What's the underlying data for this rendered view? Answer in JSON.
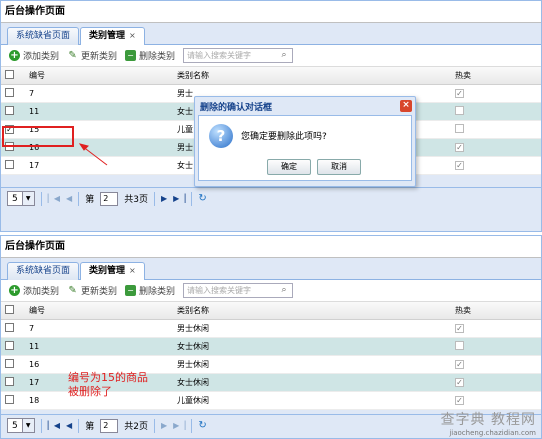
{
  "panel_title": "后台操作页面",
  "tabs": [
    {
      "label": "系统缺省页面",
      "closable": false
    },
    {
      "label": "类别管理",
      "closable": true,
      "close_glyph": "×"
    }
  ],
  "toolbar": {
    "add_label": "添加类别",
    "update_label": "更新类别",
    "delete_label": "删除类别",
    "search_placeholder": "请输入搜索关键字"
  },
  "grid_columns": {
    "num": "编号",
    "name": "类别名称",
    "hot": "热卖"
  },
  "grid_before": {
    "rows": [
      {
        "num": "7",
        "name": "男士",
        "hot_checked": true
      },
      {
        "num": "11",
        "name": "女士",
        "hot_checked": false
      },
      {
        "num": "15",
        "name": "儿童",
        "hot_checked": false,
        "selected": true
      },
      {
        "num": "16",
        "name": "男士",
        "hot_checked": true
      },
      {
        "num": "17",
        "name": "女士",
        "hot_checked": true
      }
    ]
  },
  "pager_before": {
    "page_size": "5",
    "page_prefix": "第",
    "page_value": "2",
    "page_total": "共3页"
  },
  "dialog": {
    "title": "删除的确认对话框",
    "message": "您确定要删除此项吗?",
    "ok_label": "确定",
    "cancel_label": "取消"
  },
  "grid_after": {
    "rows": [
      {
        "num": "7",
        "name": "男士休闲",
        "hot_checked": true
      },
      {
        "num": "11",
        "name": "女士休闲",
        "hot_checked": false
      },
      {
        "num": "16",
        "name": "男士休闲",
        "hot_checked": true
      },
      {
        "num": "17",
        "name": "女士休闲",
        "hot_checked": true
      },
      {
        "num": "18",
        "name": "儿童休闲",
        "hot_checked": true
      }
    ]
  },
  "pager_after": {
    "page_size": "5",
    "page_prefix": "第",
    "page_value": "2",
    "page_total": "共2页"
  },
  "annotation": {
    "line1": "编号为15的商品",
    "line2": "被删除了",
    "color": "#e02020"
  },
  "watermark": {
    "line1": "查字典 教程网",
    "line2": "jiaocheng.chazidian.com"
  }
}
